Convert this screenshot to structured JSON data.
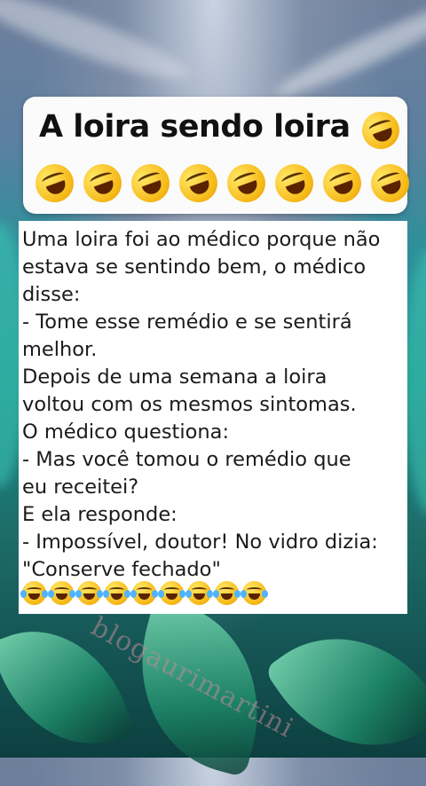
{
  "title_card": {
    "title": "A loira sendo loira",
    "emoji_icon": "rolling-on-floor-laughing-emoji",
    "emoji_count": 8
  },
  "joke": {
    "lines": [
      "Uma loira foi ao médico porque não",
      " estava se sentindo bem, o médico",
      " disse:",
      "- Tome esse remédio e se sentirá",
      " melhor.",
      "Depois de uma semana a loira",
      "voltou com os mesmos sintomas.",
      " O médico questiona:",
      "- Mas você tomou o remédio que",
      "eu receitei?",
      "E ela responde:",
      "- Impossível, doutor! No vidro dizia:",
      " \"Conserve fechado\""
    ],
    "watermark": "blogaurimartini",
    "laugh_icon": "face-with-tears-of-joy-emoji",
    "laugh_count": 9
  }
}
